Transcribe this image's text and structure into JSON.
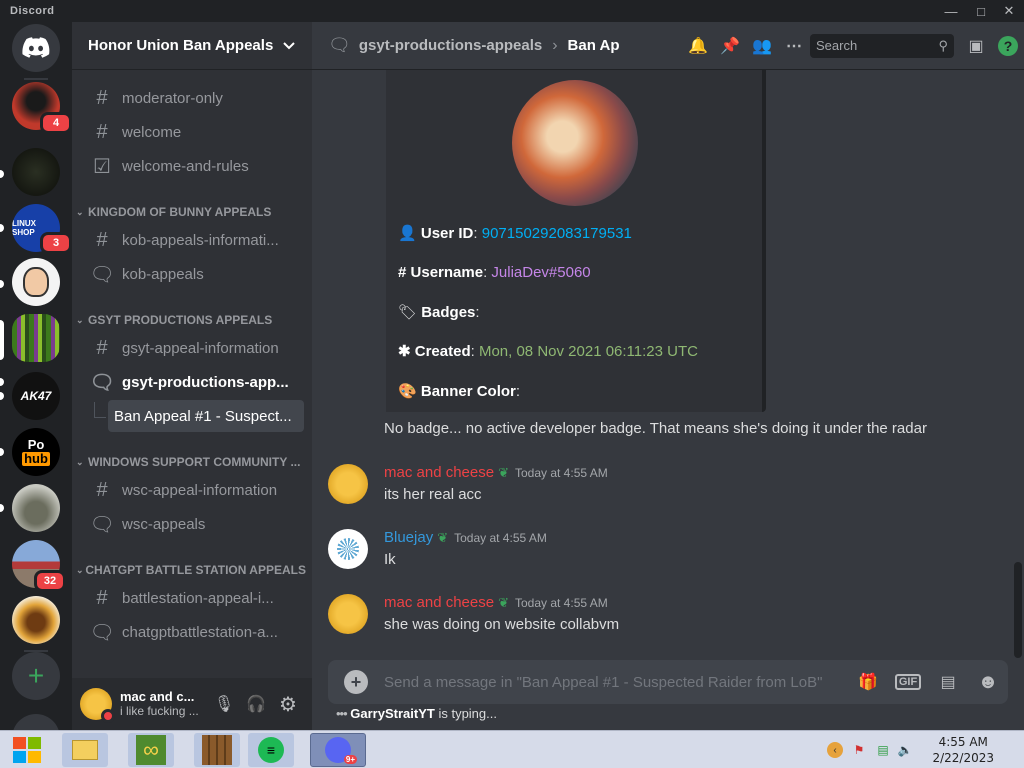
{
  "app": {
    "title": "Discord"
  },
  "guilds": [
    {
      "name": "server-1",
      "badge": "4"
    },
    {
      "name": "server-2"
    },
    {
      "name": "server-3",
      "badge": "3",
      "label": "LINUX SHOP"
    },
    {
      "name": "server-4"
    },
    {
      "name": "server-5"
    },
    {
      "name": "server-6",
      "label": "AK47"
    },
    {
      "name": "server-7",
      "label_top": "Po",
      "label_hub": "hub"
    },
    {
      "name": "server-8"
    },
    {
      "name": "server-9",
      "badge": "32"
    },
    {
      "name": "server-10"
    }
  ],
  "sidebar": {
    "server_name": "Honor Union Ban Appeals",
    "channels_top": [
      {
        "label": "moderator-only",
        "icon": "hash-icon"
      },
      {
        "label": "welcome",
        "icon": "hash-icon"
      },
      {
        "label": "welcome-and-rules",
        "icon": "rules-icon"
      }
    ],
    "categories": [
      {
        "label": "KINGDOM OF BUNNY APPEALS",
        "channels": [
          {
            "label": "kob-appeals-informati...",
            "icon": "hash-icon"
          },
          {
            "label": "kob-appeals",
            "icon": "forum-icon"
          }
        ]
      },
      {
        "label": "GSYT PRODUCTIONS APPEALS",
        "channels": [
          {
            "label": "gsyt-appeal-information",
            "icon": "hash-icon"
          },
          {
            "label": "gsyt-productions-app...",
            "icon": "forum-icon"
          },
          {
            "label": "Ban Appeal #1 - Suspect...",
            "icon": "thread-icon"
          }
        ]
      },
      {
        "label": "WINDOWS SUPPORT COMMUNITY ...",
        "channels": [
          {
            "label": "wsc-appeal-information",
            "icon": "hash-icon"
          },
          {
            "label": "wsc-appeals",
            "icon": "forum-icon"
          }
        ]
      },
      {
        "label": "CHATGPT BATTLE STATION APPEALS",
        "channels": [
          {
            "label": "battlestation-appeal-i...",
            "icon": "hash-icon"
          },
          {
            "label": "chatgptbattlestation-a...",
            "icon": "forum-icon"
          }
        ]
      }
    ],
    "user": {
      "name": "mac and c...",
      "status": "i like fucking ..."
    }
  },
  "topbar": {
    "channel": "gsyt-productions-appeals",
    "thread": "Ban Ap",
    "search_placeholder": "Search"
  },
  "embed": {
    "user_id_label": "User ID",
    "user_id": "907150292083179531",
    "username_label": "Username",
    "username": "JuliaDev#5060",
    "badges_label": "Badges",
    "created_label": "Created",
    "created": "Mon, 08 Nov 2021 06:11:23 UTC",
    "banner_label": "Banner Color"
  },
  "messages": [
    {
      "content": "No badge... no active developer badge. That means she's doing it under the radar"
    },
    {
      "author": "mac and cheese",
      "author_color": "#ed4245",
      "time": "Today at 4:55 AM",
      "content": "its her real acc"
    },
    {
      "author": "Bluejay",
      "author_color": "#3498db",
      "time": "Today at 4:55 AM",
      "content": "Ik"
    },
    {
      "author": "mac and cheese",
      "author_color": "#ed4245",
      "time": "Today at 4:55 AM",
      "content": "she was doing on website collabvm"
    }
  ],
  "composer": {
    "placeholder": "Send a message in \"Ban Appeal #1 - Suspected Raider from LoB\"",
    "gif": "GIF"
  },
  "typing": {
    "user": "GarryStraitYT",
    "text": "is typing..."
  },
  "taskbar": {
    "time": "4:55 AM",
    "date": "2/22/2023",
    "discord_badge": "9+"
  }
}
